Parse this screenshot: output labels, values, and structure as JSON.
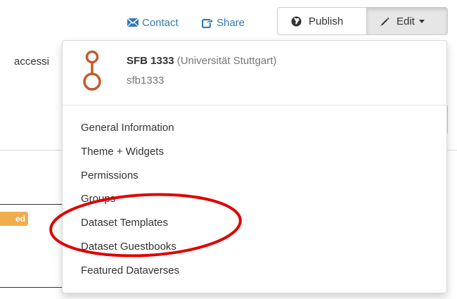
{
  "header": {
    "contact_label": "Contact",
    "share_label": "Share",
    "publish_label": "Publish",
    "edit_label": "Edit"
  },
  "background": {
    "fragment_text": "accessi",
    "badge_text": "ed"
  },
  "dropdown": {
    "dataverse_name": "SFB 1333",
    "affiliation": "(Universität Stuttgart)",
    "alias": "sfb1333",
    "items": [
      {
        "label": "General Information"
      },
      {
        "label": "Theme + Widgets"
      },
      {
        "label": "Permissions"
      },
      {
        "label": "Groups"
      },
      {
        "label": "Dataset Templates"
      },
      {
        "label": "Dataset Guestbooks"
      },
      {
        "label": "Featured Dataverses"
      }
    ]
  },
  "colors": {
    "link": "#337ab7",
    "logo": "#c55a28",
    "annotation": "#e00000",
    "badge": "#f0ad4e"
  },
  "icons": {
    "contact": "envelope-icon",
    "share": "share-icon",
    "publish": "globe-icon",
    "edit": "pencil-icon"
  }
}
